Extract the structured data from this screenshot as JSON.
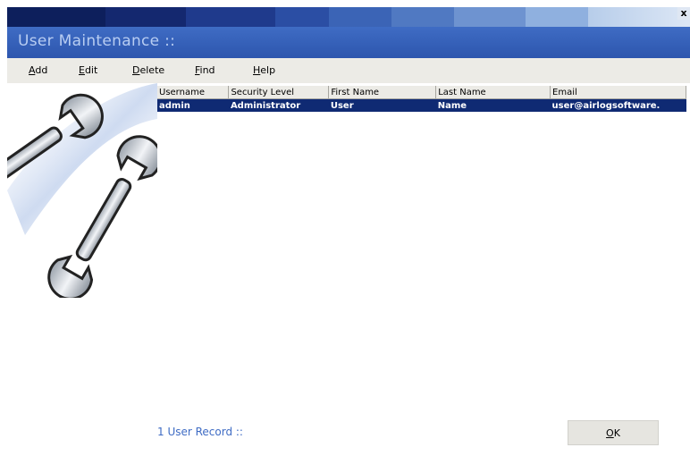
{
  "window": {
    "close_glyph": "x"
  },
  "header": {
    "title": "User Maintenance ::"
  },
  "menu": [
    {
      "label": "Add",
      "mnemonic": "A"
    },
    {
      "label": "Edit",
      "mnemonic": "E"
    },
    {
      "label": "Delete",
      "mnemonic": "D"
    },
    {
      "label": "Find",
      "mnemonic": "F"
    },
    {
      "label": "Help",
      "mnemonic": "H"
    }
  ],
  "grid": {
    "columns": [
      "Username",
      "Security Level",
      "First Name",
      "Last Name",
      "Email"
    ],
    "rows": [
      {
        "username": "admin",
        "security_level": "Administrator",
        "first_name": "User",
        "last_name": "Name",
        "email": "user@airlogsoftware."
      }
    ]
  },
  "footer": {
    "records_text": "1 User Record ::",
    "ok_label": "OK"
  },
  "colors": {
    "header_bg": "#3f6cc4",
    "selected_row": "#0f2a73",
    "records_text": "#3f6cc4"
  },
  "art": {
    "icon": "wrenches-icon"
  }
}
